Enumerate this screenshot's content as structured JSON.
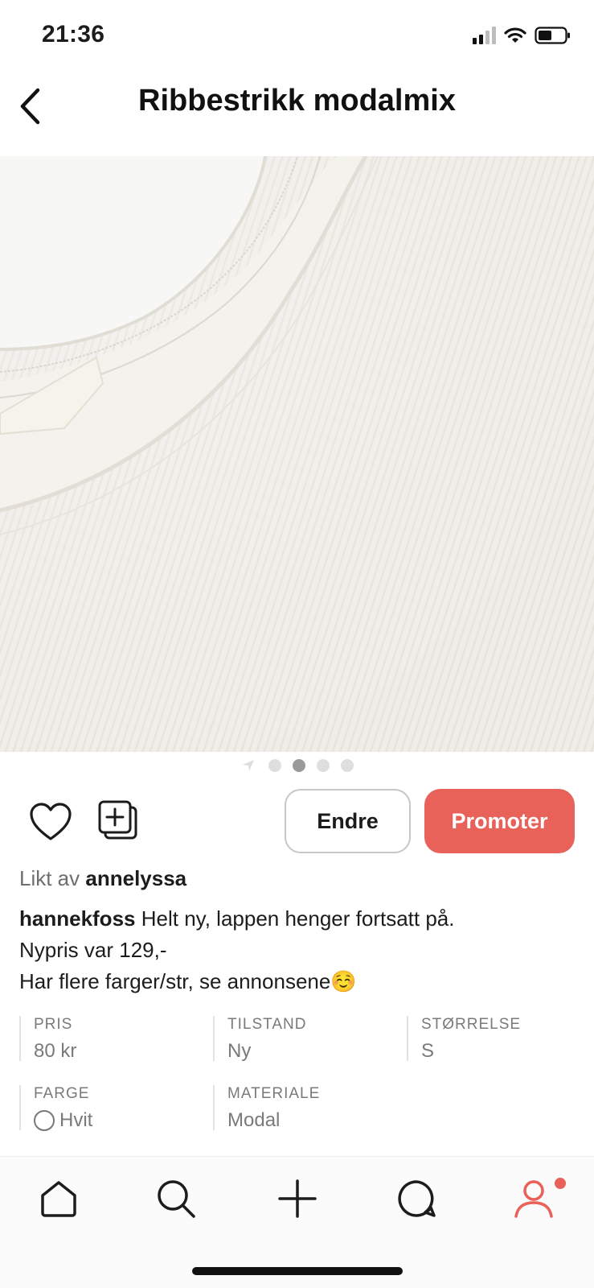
{
  "status": {
    "time": "21:36"
  },
  "nav": {
    "title": "Ribbestrikk modalmix"
  },
  "carousel": {
    "total": 4,
    "active_index": 1
  },
  "actions": {
    "edit_label": "Endre",
    "promote_label": "Promoter"
  },
  "likes": {
    "prefix": "Likt av",
    "user": "annelyssa"
  },
  "description": {
    "username": "hannekfoss",
    "line1": "Helt ny, lappen henger fortsatt på.",
    "line2": "Nypris var 129,-",
    "line3": "Har flere farger/str, se annonsene",
    "emoji": "☺️"
  },
  "attributes": {
    "price": {
      "label": "PRIS",
      "value": "80 kr"
    },
    "condition": {
      "label": "TILSTAND",
      "value": "Ny"
    },
    "size": {
      "label": "STØRRELSE",
      "value": "S"
    },
    "color": {
      "label": "FARGE",
      "value": "Hvit"
    },
    "material": {
      "label": "MATERIALE",
      "value": "Modal"
    }
  },
  "tabbar": {
    "items": [
      "home-icon",
      "search-icon",
      "plus-icon",
      "chat-icon",
      "profile-icon"
    ],
    "accent": "#e8625a"
  },
  "colors": {
    "promote": "#e8625a",
    "photo_fabric": "#efede8"
  }
}
